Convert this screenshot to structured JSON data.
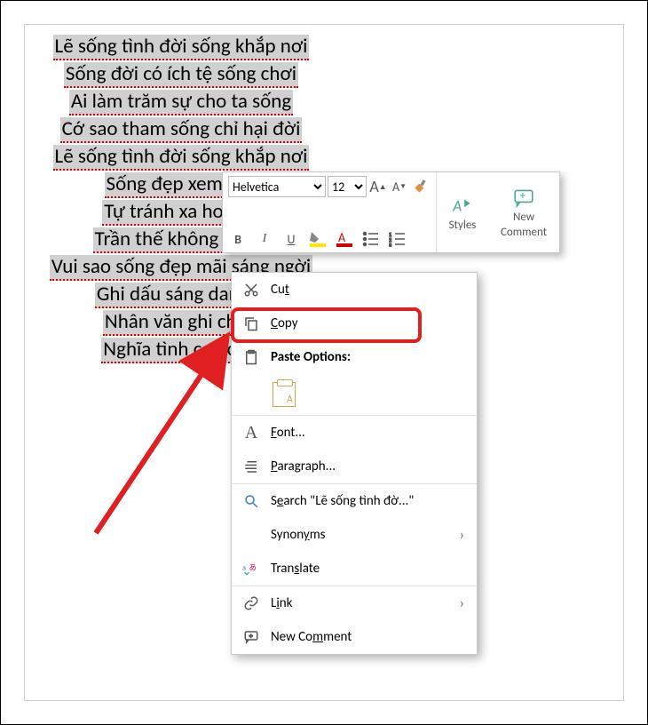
{
  "poem": {
    "lines": [
      "Lẽ sống tình đời sống khắp nơi",
      "Sống đời có ích tệ sống chơi",
      "Ai làm trăm sự cho ta sống",
      "Cớ sao tham sống chỉ hại đời",
      "Lẽ sống tình đời sống khắp nơi",
      "Sống đẹp xem ai g",
      "Tự tránh xa hoa ng",
      "Trần thế không nên s",
      "Vui sao sống đẹp mãi sáng ngời",
      "Ghi dấu sáng danh n",
      "Nhân văn ghi chép",
      "Nghĩa tình cao cả v"
    ]
  },
  "toolbar": {
    "font": "Helvetica",
    "size": "12",
    "styles_label": "Styles",
    "new_comment_line1": "New",
    "new_comment_line2": "Comment"
  },
  "context_menu": {
    "cut": "Cut",
    "copy": "Copy",
    "paste_options": "Paste Options:",
    "font": "Font...",
    "paragraph": "Paragraph...",
    "search": "Search \"Lẽ sống tình đờ...\"",
    "synonyms": "Synonyms",
    "translate": "Translate",
    "link": "Link",
    "new_comment": "New Comment"
  }
}
